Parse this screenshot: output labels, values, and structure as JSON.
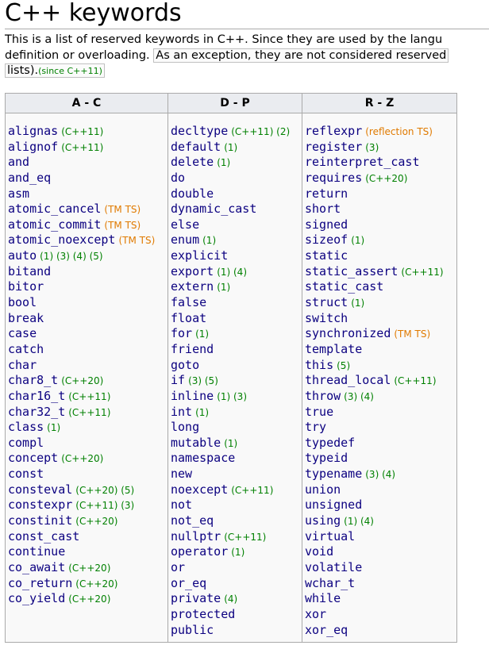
{
  "page": {
    "title": "C++ keywords",
    "intro_line1": "This is a list of reserved keywords in C++. Since they are used by the langu",
    "intro_line2_a": "definition or overloading.",
    "intro_line2_b": "As an exception, they are not considered reserved",
    "intro_line3": "lists).",
    "intro_since": "(since C++11)"
  },
  "colors": {
    "link": "#0b0080",
    "note_green": "#008000",
    "note_orange": "#e07a00",
    "header_bg": "#eaecf0"
  },
  "table": {
    "headers": [
      "A - C",
      "D - P",
      "R - Z"
    ],
    "columns": [
      [
        {
          "k": "alignas",
          "n": "(C++11)",
          "c": "g"
        },
        {
          "k": "alignof",
          "n": "(C++11)",
          "c": "g"
        },
        {
          "k": "and",
          "n": "",
          "c": "g"
        },
        {
          "k": "and_eq",
          "n": "",
          "c": "g"
        },
        {
          "k": "asm",
          "n": "",
          "c": "g"
        },
        {
          "k": "atomic_cancel",
          "n": "(TM TS)",
          "c": "o"
        },
        {
          "k": "atomic_commit",
          "n": "(TM TS)",
          "c": "o"
        },
        {
          "k": "atomic_noexcept",
          "n": "(TM TS)",
          "c": "o"
        },
        {
          "k": "auto",
          "n": "(1) (3) (4) (5)",
          "c": "g"
        },
        {
          "k": "bitand",
          "n": "",
          "c": "g"
        },
        {
          "k": "bitor",
          "n": "",
          "c": "g"
        },
        {
          "k": "bool",
          "n": "",
          "c": "g"
        },
        {
          "k": "break",
          "n": "",
          "c": "g"
        },
        {
          "k": "case",
          "n": "",
          "c": "g"
        },
        {
          "k": "catch",
          "n": "",
          "c": "g"
        },
        {
          "k": "char",
          "n": "",
          "c": "g"
        },
        {
          "k": "char8_t",
          "n": "(C++20)",
          "c": "g"
        },
        {
          "k": "char16_t",
          "n": "(C++11)",
          "c": "g"
        },
        {
          "k": "char32_t",
          "n": "(C++11)",
          "c": "g"
        },
        {
          "k": "class",
          "n": "(1)",
          "c": "g"
        },
        {
          "k": "compl",
          "n": "",
          "c": "g"
        },
        {
          "k": "concept",
          "n": "(C++20)",
          "c": "g"
        },
        {
          "k": "const",
          "n": "",
          "c": "g"
        },
        {
          "k": "consteval",
          "n": "(C++20) (5)",
          "c": "g"
        },
        {
          "k": "constexpr",
          "n": "(C++11) (3)",
          "c": "g"
        },
        {
          "k": "constinit",
          "n": "(C++20)",
          "c": "g"
        },
        {
          "k": "const_cast",
          "n": "",
          "c": "g"
        },
        {
          "k": "continue",
          "n": "",
          "c": "g"
        },
        {
          "k": "co_await",
          "n": "(C++20)",
          "c": "g"
        },
        {
          "k": "co_return",
          "n": "(C++20)",
          "c": "g"
        },
        {
          "k": "co_yield",
          "n": "(C++20)",
          "c": "g"
        }
      ],
      [
        {
          "k": "decltype",
          "n": "(C++11) (2)",
          "c": "g"
        },
        {
          "k": "default",
          "n": "(1)",
          "c": "g"
        },
        {
          "k": "delete",
          "n": "(1)",
          "c": "g"
        },
        {
          "k": "do",
          "n": "",
          "c": "g"
        },
        {
          "k": "double",
          "n": "",
          "c": "g"
        },
        {
          "k": "dynamic_cast",
          "n": "",
          "c": "g"
        },
        {
          "k": "else",
          "n": "",
          "c": "g"
        },
        {
          "k": "enum",
          "n": "(1)",
          "c": "g"
        },
        {
          "k": "explicit",
          "n": "",
          "c": "g"
        },
        {
          "k": "export",
          "n": "(1) (4)",
          "c": "g"
        },
        {
          "k": "extern",
          "n": "(1)",
          "c": "g"
        },
        {
          "k": "false",
          "n": "",
          "c": "g"
        },
        {
          "k": "float",
          "n": "",
          "c": "g"
        },
        {
          "k": "for",
          "n": "(1)",
          "c": "g"
        },
        {
          "k": "friend",
          "n": "",
          "c": "g"
        },
        {
          "k": "goto",
          "n": "",
          "c": "g"
        },
        {
          "k": "if",
          "n": "(3) (5)",
          "c": "g"
        },
        {
          "k": "inline",
          "n": "(1) (3)",
          "c": "g"
        },
        {
          "k": "int",
          "n": "(1)",
          "c": "g"
        },
        {
          "k": "long",
          "n": "",
          "c": "g"
        },
        {
          "k": "mutable",
          "n": "(1)",
          "c": "g"
        },
        {
          "k": "namespace",
          "n": "",
          "c": "g"
        },
        {
          "k": "new",
          "n": "",
          "c": "g"
        },
        {
          "k": "noexcept",
          "n": "(C++11)",
          "c": "g"
        },
        {
          "k": "not",
          "n": "",
          "c": "g"
        },
        {
          "k": "not_eq",
          "n": "",
          "c": "g"
        },
        {
          "k": "nullptr",
          "n": "(C++11)",
          "c": "g"
        },
        {
          "k": "operator",
          "n": "(1)",
          "c": "g"
        },
        {
          "k": "or",
          "n": "",
          "c": "g"
        },
        {
          "k": "or_eq",
          "n": "",
          "c": "g"
        },
        {
          "k": "private",
          "n": "(4)",
          "c": "g"
        },
        {
          "k": "protected",
          "n": "",
          "c": "g"
        },
        {
          "k": "public",
          "n": "",
          "c": "g"
        }
      ],
      [
        {
          "k": "reflexpr",
          "n": "(reflection TS)",
          "c": "o"
        },
        {
          "k": "register",
          "n": "(3)",
          "c": "g"
        },
        {
          "k": "reinterpret_cast",
          "n": "",
          "c": "g"
        },
        {
          "k": "requires",
          "n": "(C++20)",
          "c": "g"
        },
        {
          "k": "return",
          "n": "",
          "c": "g"
        },
        {
          "k": "short",
          "n": "",
          "c": "g"
        },
        {
          "k": "signed",
          "n": "",
          "c": "g"
        },
        {
          "k": "sizeof",
          "n": "(1)",
          "c": "g"
        },
        {
          "k": "static",
          "n": "",
          "c": "g"
        },
        {
          "k": "static_assert",
          "n": "(C++11)",
          "c": "g"
        },
        {
          "k": "static_cast",
          "n": "",
          "c": "g"
        },
        {
          "k": "struct",
          "n": "(1)",
          "c": "g"
        },
        {
          "k": "switch",
          "n": "",
          "c": "g"
        },
        {
          "k": "synchronized",
          "n": "(TM TS)",
          "c": "o"
        },
        {
          "k": "template",
          "n": "",
          "c": "g"
        },
        {
          "k": "this",
          "n": "(5)",
          "c": "g"
        },
        {
          "k": "thread_local",
          "n": "(C++11)",
          "c": "g"
        },
        {
          "k": "throw",
          "n": "(3) (4)",
          "c": "g"
        },
        {
          "k": "true",
          "n": "",
          "c": "g"
        },
        {
          "k": "try",
          "n": "",
          "c": "g"
        },
        {
          "k": "typedef",
          "n": "",
          "c": "g"
        },
        {
          "k": "typeid",
          "n": "",
          "c": "g"
        },
        {
          "k": "typename",
          "n": "(3) (4)",
          "c": "g"
        },
        {
          "k": "union",
          "n": "",
          "c": "g"
        },
        {
          "k": "unsigned",
          "n": "",
          "c": "g"
        },
        {
          "k": "using",
          "n": "(1) (4)",
          "c": "g"
        },
        {
          "k": "virtual",
          "n": "",
          "c": "g"
        },
        {
          "k": "void",
          "n": "",
          "c": "g"
        },
        {
          "k": "volatile",
          "n": "",
          "c": "g"
        },
        {
          "k": "wchar_t",
          "n": "",
          "c": "g"
        },
        {
          "k": "while",
          "n": "",
          "c": "g"
        },
        {
          "k": "xor",
          "n": "",
          "c": "g"
        },
        {
          "k": "xor_eq",
          "n": "",
          "c": "g"
        }
      ]
    ]
  }
}
